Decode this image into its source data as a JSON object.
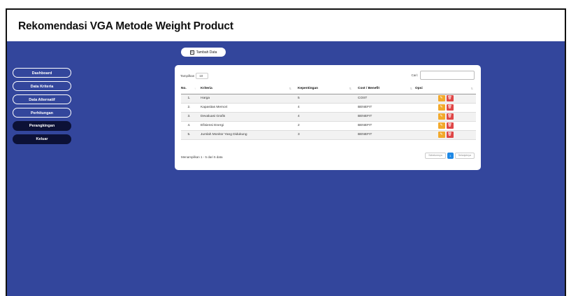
{
  "header": {
    "title": "Rekomendasi VGA Metode Weight Product"
  },
  "sidebar": {
    "items": [
      {
        "label": "Dashboard"
      },
      {
        "label": "Data Kriteria"
      },
      {
        "label": "Data Alternatif"
      },
      {
        "label": "Perhitungan"
      },
      {
        "label": "Perangkingan"
      },
      {
        "label": "Keluar"
      }
    ]
  },
  "toolbar": {
    "add_label": "Tambah Data",
    "add_icon": "plus-square-icon"
  },
  "table_controls": {
    "show_label": "Tampilkan",
    "show_value": "10",
    "search_label": "Cari:",
    "search_value": ""
  },
  "table": {
    "headers": [
      "No.",
      "Kriteria",
      "Kepentingan",
      "Cost / Benefit",
      "Opsi"
    ],
    "rows": [
      {
        "no": "1.",
        "kriteria": "Harga",
        "kepentingan": "5",
        "cost_benefit": "COST"
      },
      {
        "no": "2.",
        "kriteria": "Kapasitas Memori",
        "kepentingan": "4",
        "cost_benefit": "BENEFIT"
      },
      {
        "no": "3.",
        "kriteria": "Devaluasi Grafis",
        "kepentingan": "4",
        "cost_benefit": "BENEFIT"
      },
      {
        "no": "4.",
        "kriteria": "Efisiensi Energi",
        "kepentingan": "2",
        "cost_benefit": "BENEFIT"
      },
      {
        "no": "5.",
        "kriteria": "Jumlah Monitor Yang Didukung",
        "kepentingan": "3",
        "cost_benefit": "BENEFIT"
      }
    ],
    "sort_icon": "sort-arrow-icon",
    "edit_icon": "edit-icon",
    "delete_icon": "trash-icon"
  },
  "footer": {
    "info": "Menampilkan 1 - 5 dari 5 data",
    "pagination": {
      "previous": "Sebelumnya",
      "current": "1",
      "next": "Selanjutnya"
    }
  },
  "colors": {
    "primary": "#33469c",
    "sidebar_dark_button": "#0c1136",
    "edit": "#f2a92b",
    "delete": "#df4747",
    "page_active": "#1e88e5"
  }
}
